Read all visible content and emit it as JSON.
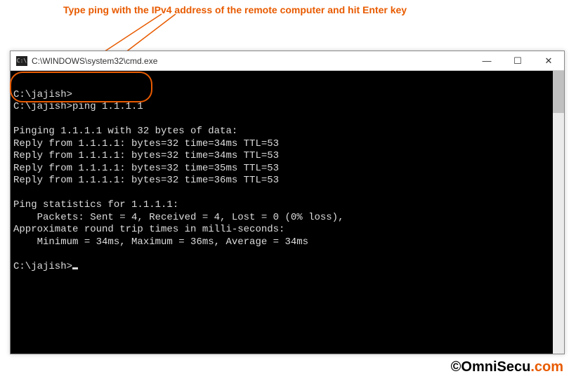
{
  "annotation": {
    "text": "Type ping with the IPv4 address of the remote computer and hit Enter key"
  },
  "window": {
    "title": "C:\\WINDOWS\\system32\\cmd.exe",
    "icon_label": "C:\\",
    "buttons": {
      "minimize": "—",
      "maximize": "☐",
      "close": "✕"
    }
  },
  "terminal": {
    "lines": {
      "p1": "C:\\jajish>",
      "p2": "C:\\jajish>ping 1.1.1.1",
      "blank1": "",
      "l1": "Pinging 1.1.1.1 with 32 bytes of data:",
      "l2": "Reply from 1.1.1.1: bytes=32 time=34ms TTL=53",
      "l3": "Reply from 1.1.1.1: bytes=32 time=34ms TTL=53",
      "l4": "Reply from 1.1.1.1: bytes=32 time=35ms TTL=53",
      "l5": "Reply from 1.1.1.1: bytes=32 time=36ms TTL=53",
      "blank2": "",
      "s1": "Ping statistics for 1.1.1.1:",
      "s2": "    Packets: Sent = 4, Received = 4, Lost = 0 (0% loss),",
      "s3": "Approximate round trip times in milli-seconds:",
      "s4": "    Minimum = 34ms, Maximum = 36ms, Average = 34ms",
      "blank3": "",
      "p3": "C:\\jajish>"
    }
  },
  "footer": {
    "copyright_prefix": "©OmniSecu",
    "copyright_suffix": ".com"
  }
}
